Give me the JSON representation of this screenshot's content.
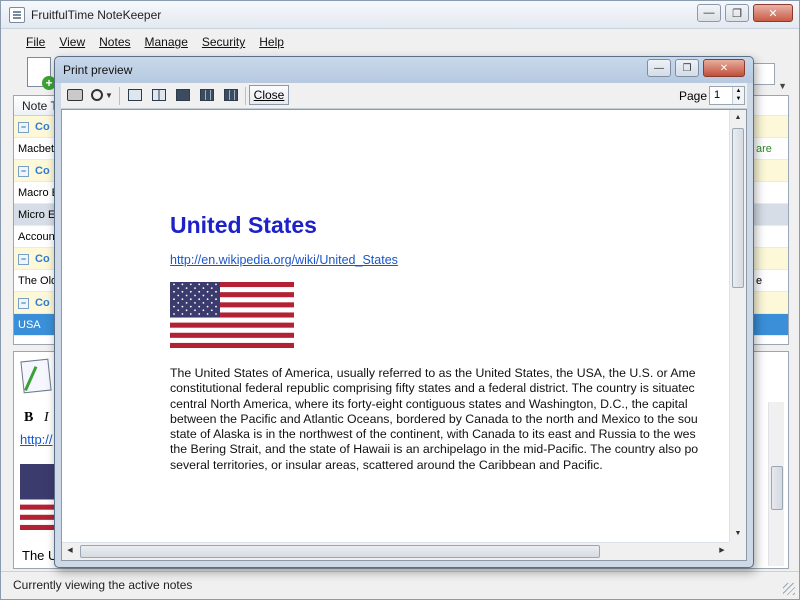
{
  "app": {
    "title": "FruitfulTime NoteKeeper"
  },
  "menu": [
    "File",
    "View",
    "Notes",
    "Manage",
    "Security",
    "Help"
  ],
  "notes_list": {
    "header": "Note Ti",
    "rows": [
      {
        "label": "Co",
        "type": "group"
      },
      {
        "label": "Macbeth",
        "type": "item"
      },
      {
        "label": "Co",
        "type": "group"
      },
      {
        "label": "Macro E",
        "type": "item"
      },
      {
        "label": "Micro Ec",
        "type": "mid"
      },
      {
        "label": "Account",
        "type": "item"
      },
      {
        "label": "Co",
        "type": "group"
      },
      {
        "label": "The Old",
        "type": "item"
      },
      {
        "label": "Co",
        "type": "group"
      },
      {
        "label": "USA",
        "type": "selected"
      }
    ]
  },
  "right_strip": {
    "fragment_are": "are",
    "fragment_e": "e"
  },
  "editor": {
    "bold": "B",
    "italic": "I",
    "link_fragment": "http://",
    "text_fragment": "The U"
  },
  "status": {
    "text": "Currently viewing the active notes"
  },
  "print_preview": {
    "title": "Print preview",
    "close_label": "Close",
    "page_label": "Page",
    "page_value": "1",
    "document": {
      "heading": "United States",
      "link": "http://en.wikipedia.org/wiki/United_States",
      "paragraph_lines": [
        "The United States of America, usually referred to as the United States, the USA, the U.S. or Ame",
        "constitutional federal republic comprising fifty states and a federal district. The country is situatec",
        "central North America, where its forty-eight contiguous states and Washington, D.C., the capital",
        "between the Pacific and Atlantic Oceans, bordered by Canada to the north and Mexico to the sou",
        "state of Alaska is in the northwest of the continent, with Canada to its east and Russia to the wes",
        "the Bering Strait, and the state of Hawaii is an archipelago in the mid-Pacific. The country also po",
        "several territories, or insular areas, scattered around the Caribbean and Pacific."
      ]
    }
  },
  "colors": {
    "heading": "#1c21c8",
    "link": "#1a56c9",
    "group_row_bg": "#fcf8d8",
    "selected_row_bg": "#3a8fd8",
    "flag_red": "#b22234",
    "flag_blue": "#3c3b6e"
  }
}
